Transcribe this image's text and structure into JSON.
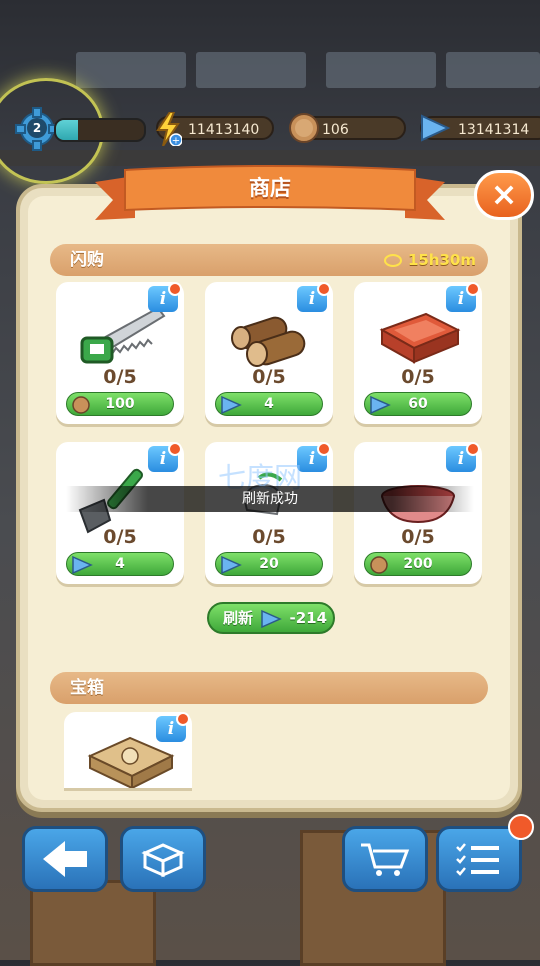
{
  "top_bar": {
    "level": "2",
    "xp_progress": 0.25,
    "energy": "11413140",
    "coins": "106",
    "gems": "13141314"
  },
  "shop": {
    "title": "商店",
    "close_label": "×"
  },
  "flash_sale": {
    "label": "闪购",
    "timer": "15h30m",
    "items": [
      {
        "icon": "saw-icon",
        "count": "0/5",
        "currency": "coin-icon",
        "price": "100"
      },
      {
        "icon": "logs-icon",
        "count": "0/5",
        "currency": "gem-icon",
        "price": "4"
      },
      {
        "icon": "brick-tray-icon",
        "count": "0/5",
        "currency": "gem-icon",
        "price": "60"
      },
      {
        "icon": "shovel-icon",
        "count": "0/5",
        "currency": "gem-icon",
        "price": "4"
      },
      {
        "icon": "gloves-icon",
        "count": "0/5",
        "currency": "gem-icon",
        "price": "20"
      },
      {
        "icon": "bowl-icon",
        "count": "0/5",
        "currency": "coin-icon",
        "price": "200"
      }
    ],
    "info_label": "i"
  },
  "toast": {
    "text": "刷新成功"
  },
  "refresh": {
    "label": "刷新",
    "cost": "-214"
  },
  "chest": {
    "label": "宝箱"
  },
  "watermark": "七度网",
  "colors": {
    "panel": "#f6eed4",
    "ribbon": "#f08a3c",
    "green": "#4fb544",
    "info_blue": "#2a8de0"
  }
}
